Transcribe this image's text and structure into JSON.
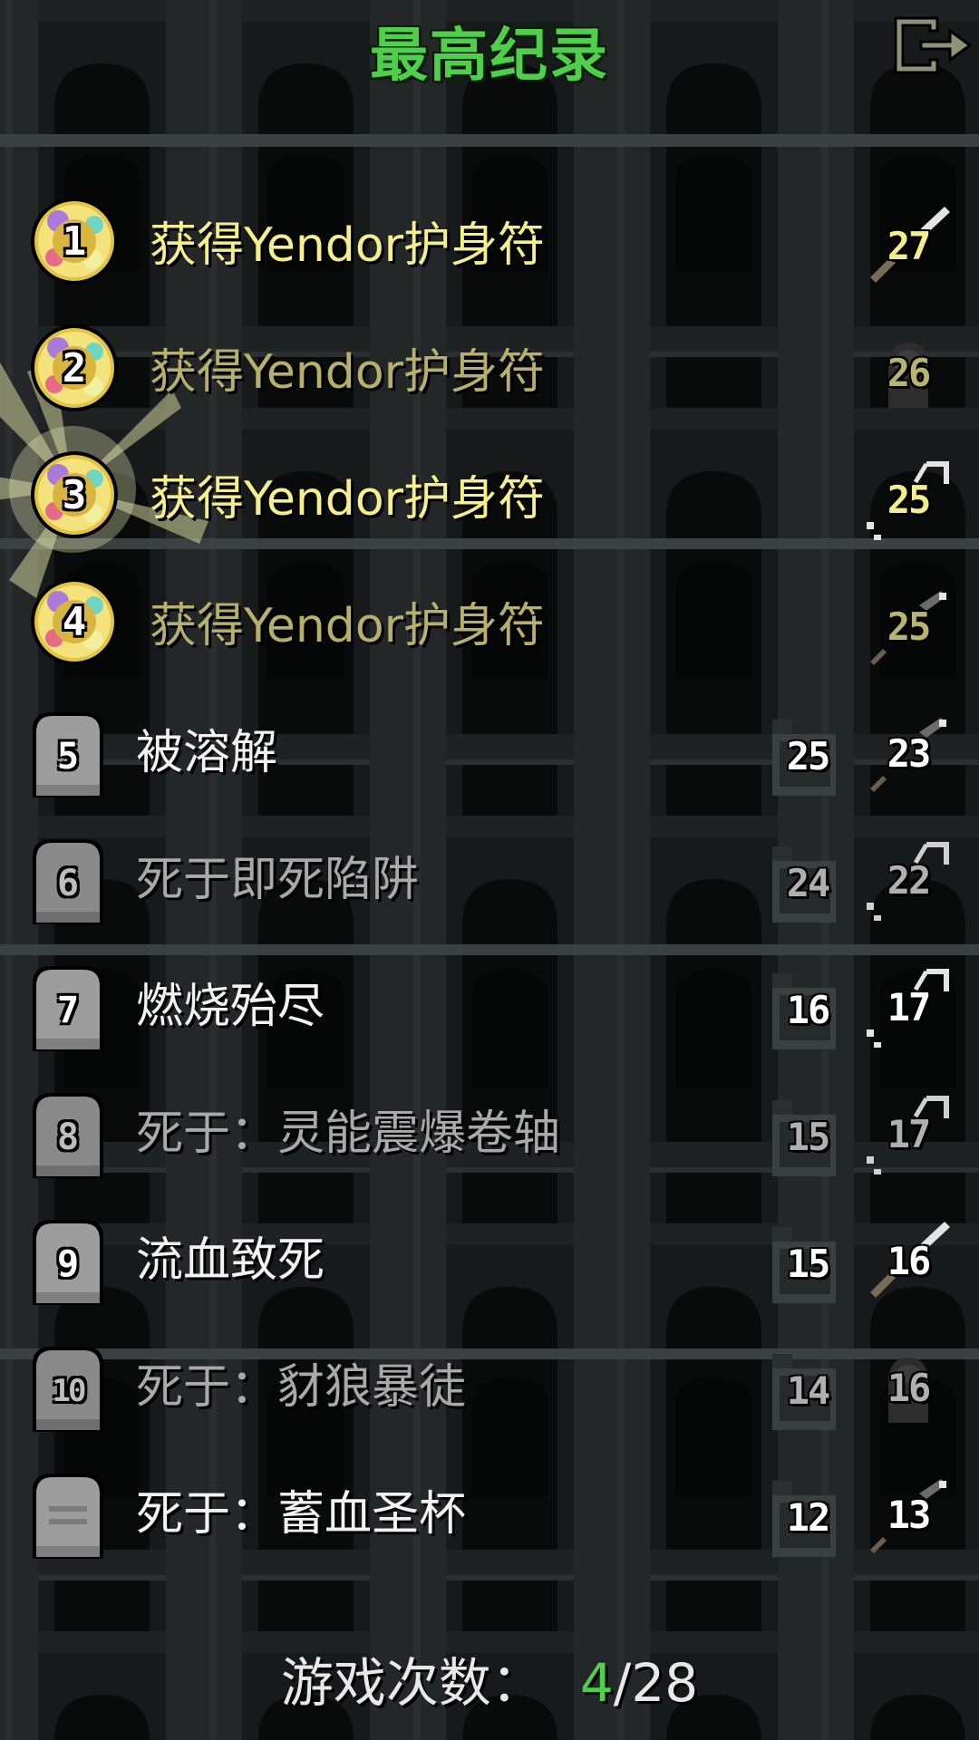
{
  "title": "最高纪录",
  "exit_icon": "exit-door-icon",
  "colors": {
    "title": "#4ed04a",
    "win_text": "#f6f08a",
    "lose_text": "#f2f2f2",
    "games_won": "#4ed04a"
  },
  "rows": [
    {
      "rank": "1",
      "cause": "获得Yendor护身符",
      "level": "27",
      "won": true,
      "class_icon": "warrior-sword-icon"
    },
    {
      "rank": "2",
      "cause": "获得Yendor护身符",
      "level": "26",
      "won": true,
      "class_icon": "mage-hood-icon"
    },
    {
      "rank": "3",
      "cause": "获得Yendor护身符",
      "level": "25",
      "won": true,
      "class_icon": "huntress-bow-icon"
    },
    {
      "rank": "4",
      "cause": "获得Yendor护身符",
      "level": "25",
      "won": true,
      "class_icon": "rogue-dagger-icon"
    },
    {
      "rank": "5",
      "cause": "被溶解",
      "depth": "25",
      "level": "23",
      "won": false,
      "class_icon": "rogue-dagger-icon"
    },
    {
      "rank": "6",
      "cause": "死于即死陷阱",
      "depth": "24",
      "level": "22",
      "won": false,
      "class_icon": "huntress-bow-icon"
    },
    {
      "rank": "7",
      "cause": "燃烧殆尽",
      "depth": "16",
      "level": "17",
      "won": false,
      "class_icon": "huntress-bow-icon"
    },
    {
      "rank": "8",
      "cause": "死于：灵能震爆卷轴",
      "depth": "15",
      "level": "17",
      "won": false,
      "class_icon": "huntress-bow-icon"
    },
    {
      "rank": "9",
      "cause": "流血致死",
      "depth": "15",
      "level": "16",
      "won": false,
      "class_icon": "warrior-sword-icon"
    },
    {
      "rank": "10",
      "cause": "死于：豺狼暴徒",
      "depth": "14",
      "level": "16",
      "won": false,
      "class_icon": "mage-hood-icon"
    },
    {
      "rank": "",
      "cause": "死于：蓄血圣杯",
      "depth": "12",
      "level": "13",
      "won": false,
      "class_icon": "rogue-dagger-icon"
    }
  ],
  "footer": {
    "label": "游戏次数：",
    "won": "4",
    "total": "/28"
  }
}
